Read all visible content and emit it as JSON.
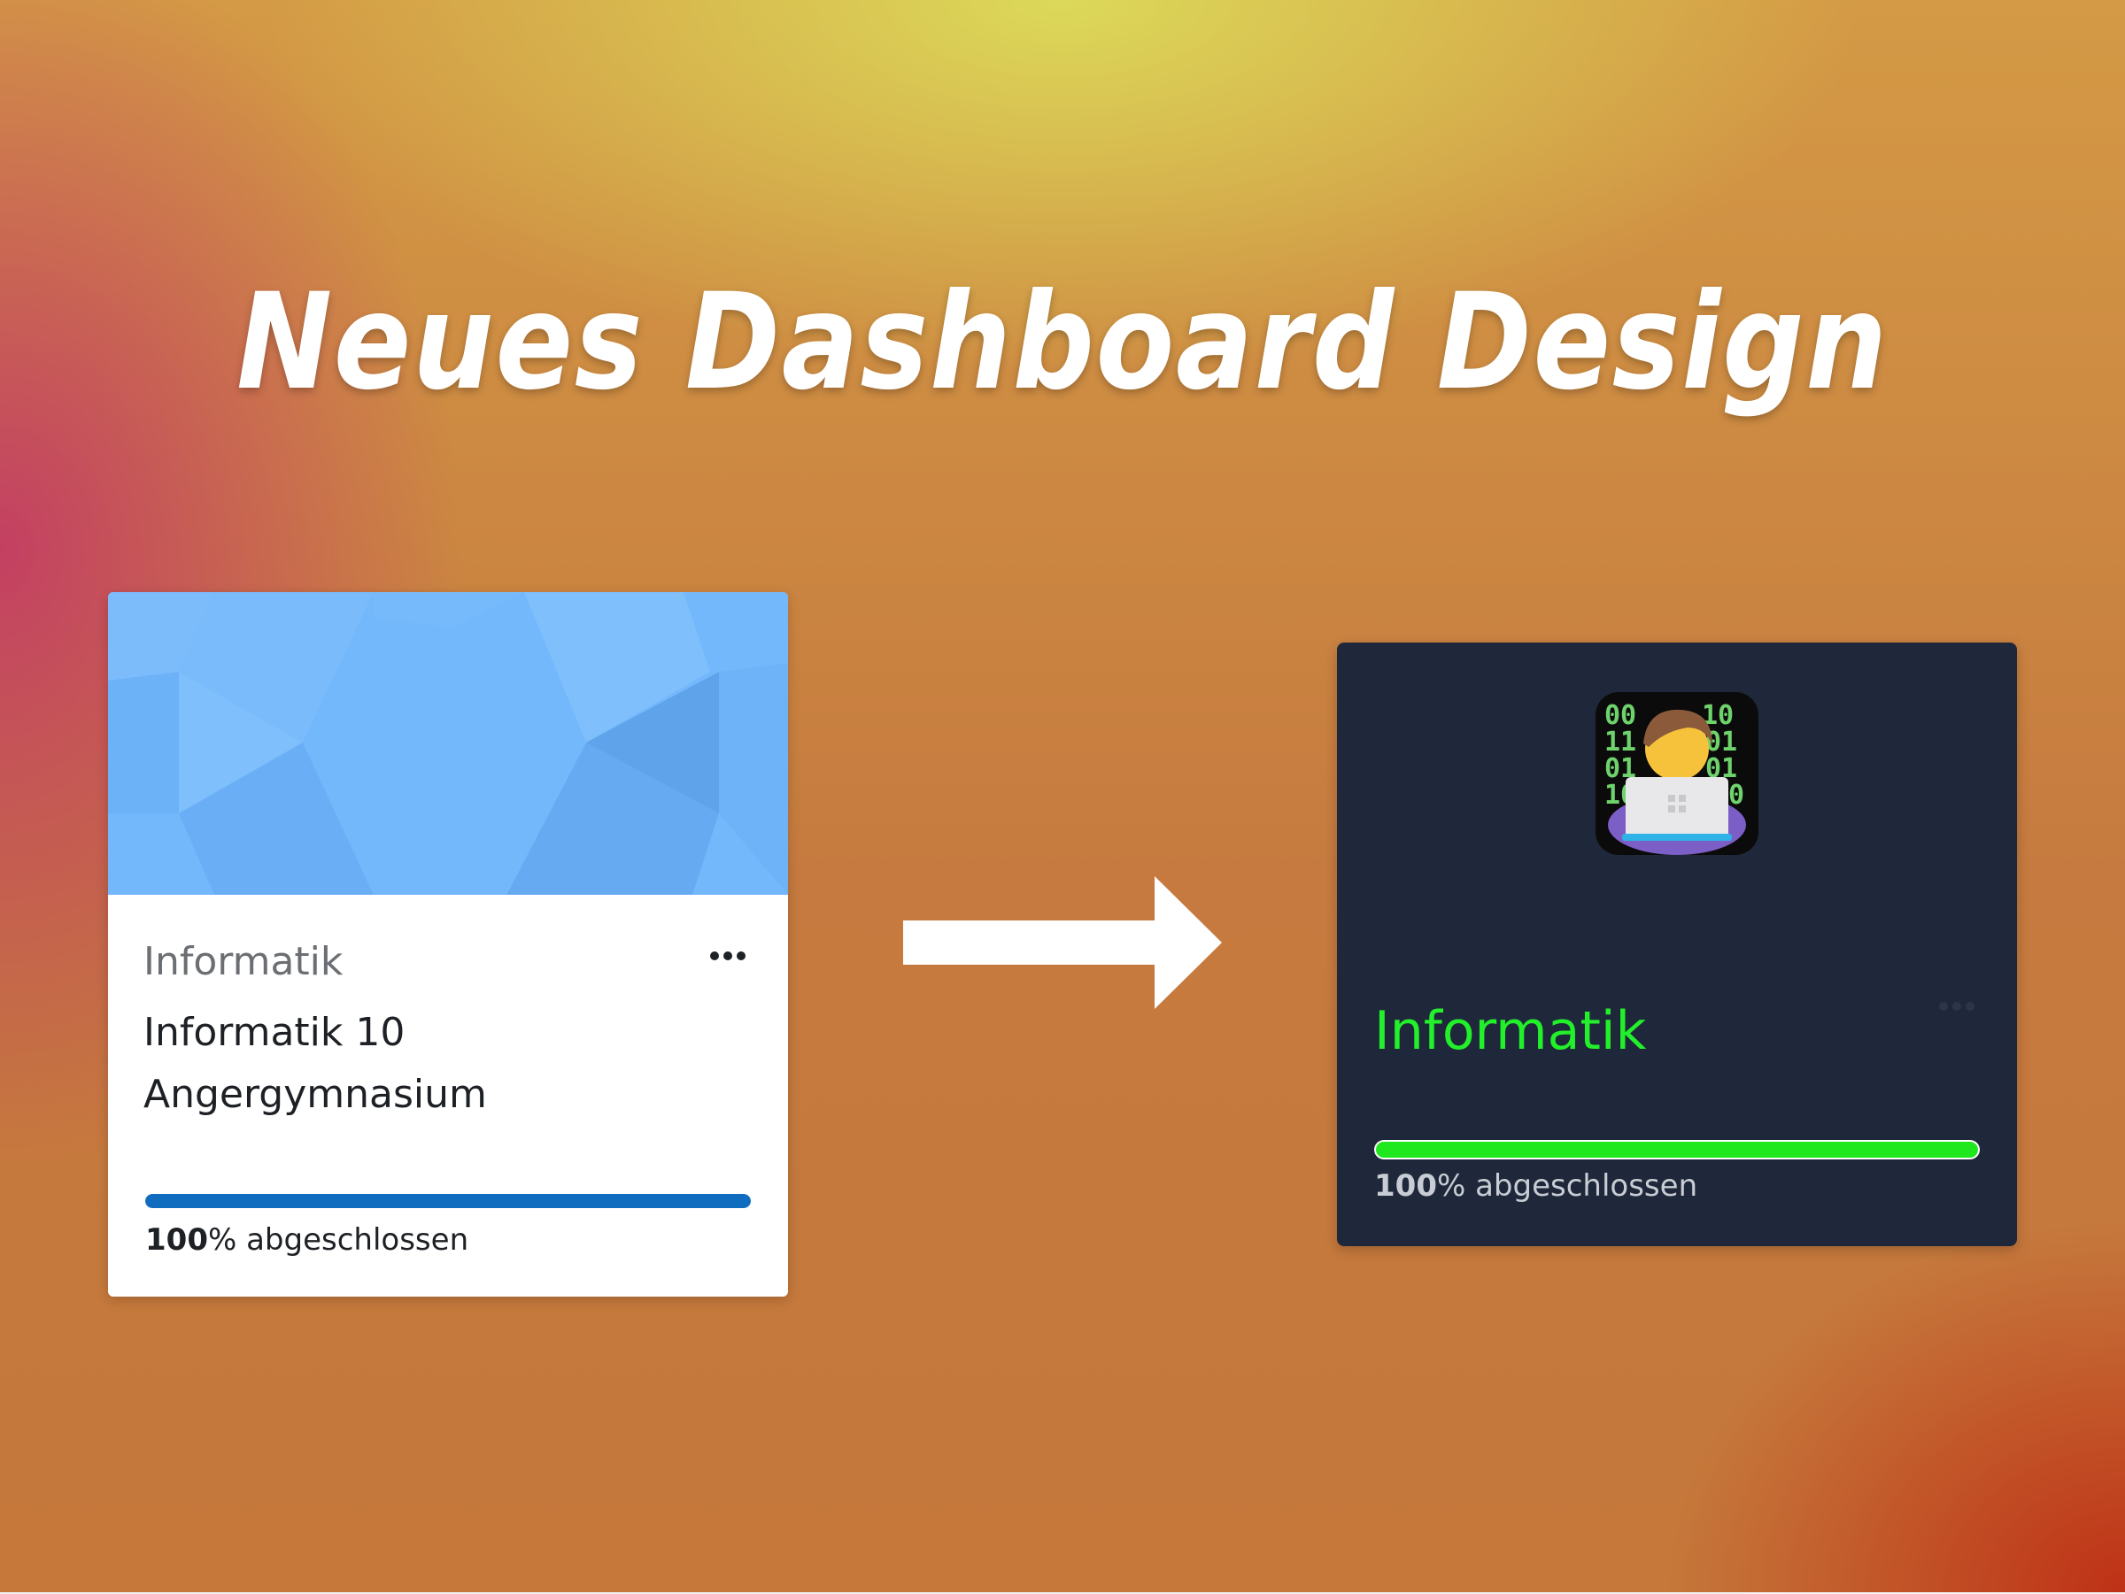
{
  "headline": "Neues Dashboard Design",
  "old_card": {
    "category": "Informatik",
    "menu_icon": "ellipsis-icon",
    "course_name": "Informatik 10",
    "school": "Angergymnasium",
    "progress_percent": 100,
    "progress_value": "100",
    "progress_suffix": "% abgeschlossen",
    "banner_color": "#74b8fc",
    "bar_color": "#0f6cbf"
  },
  "arrow_icon": "arrow-right-icon",
  "new_card": {
    "icon": "technologist-emoji-icon",
    "icon_binary_rows": [
      "00",
      "11",
      "01",
      "10"
    ],
    "category": "Informatik",
    "menu_icon": "ellipsis-icon",
    "progress_percent": 100,
    "progress_value": "100",
    "progress_suffix": "% abgeschlossen",
    "background_color": "#1f283a",
    "accent_color": "#22f02a"
  }
}
